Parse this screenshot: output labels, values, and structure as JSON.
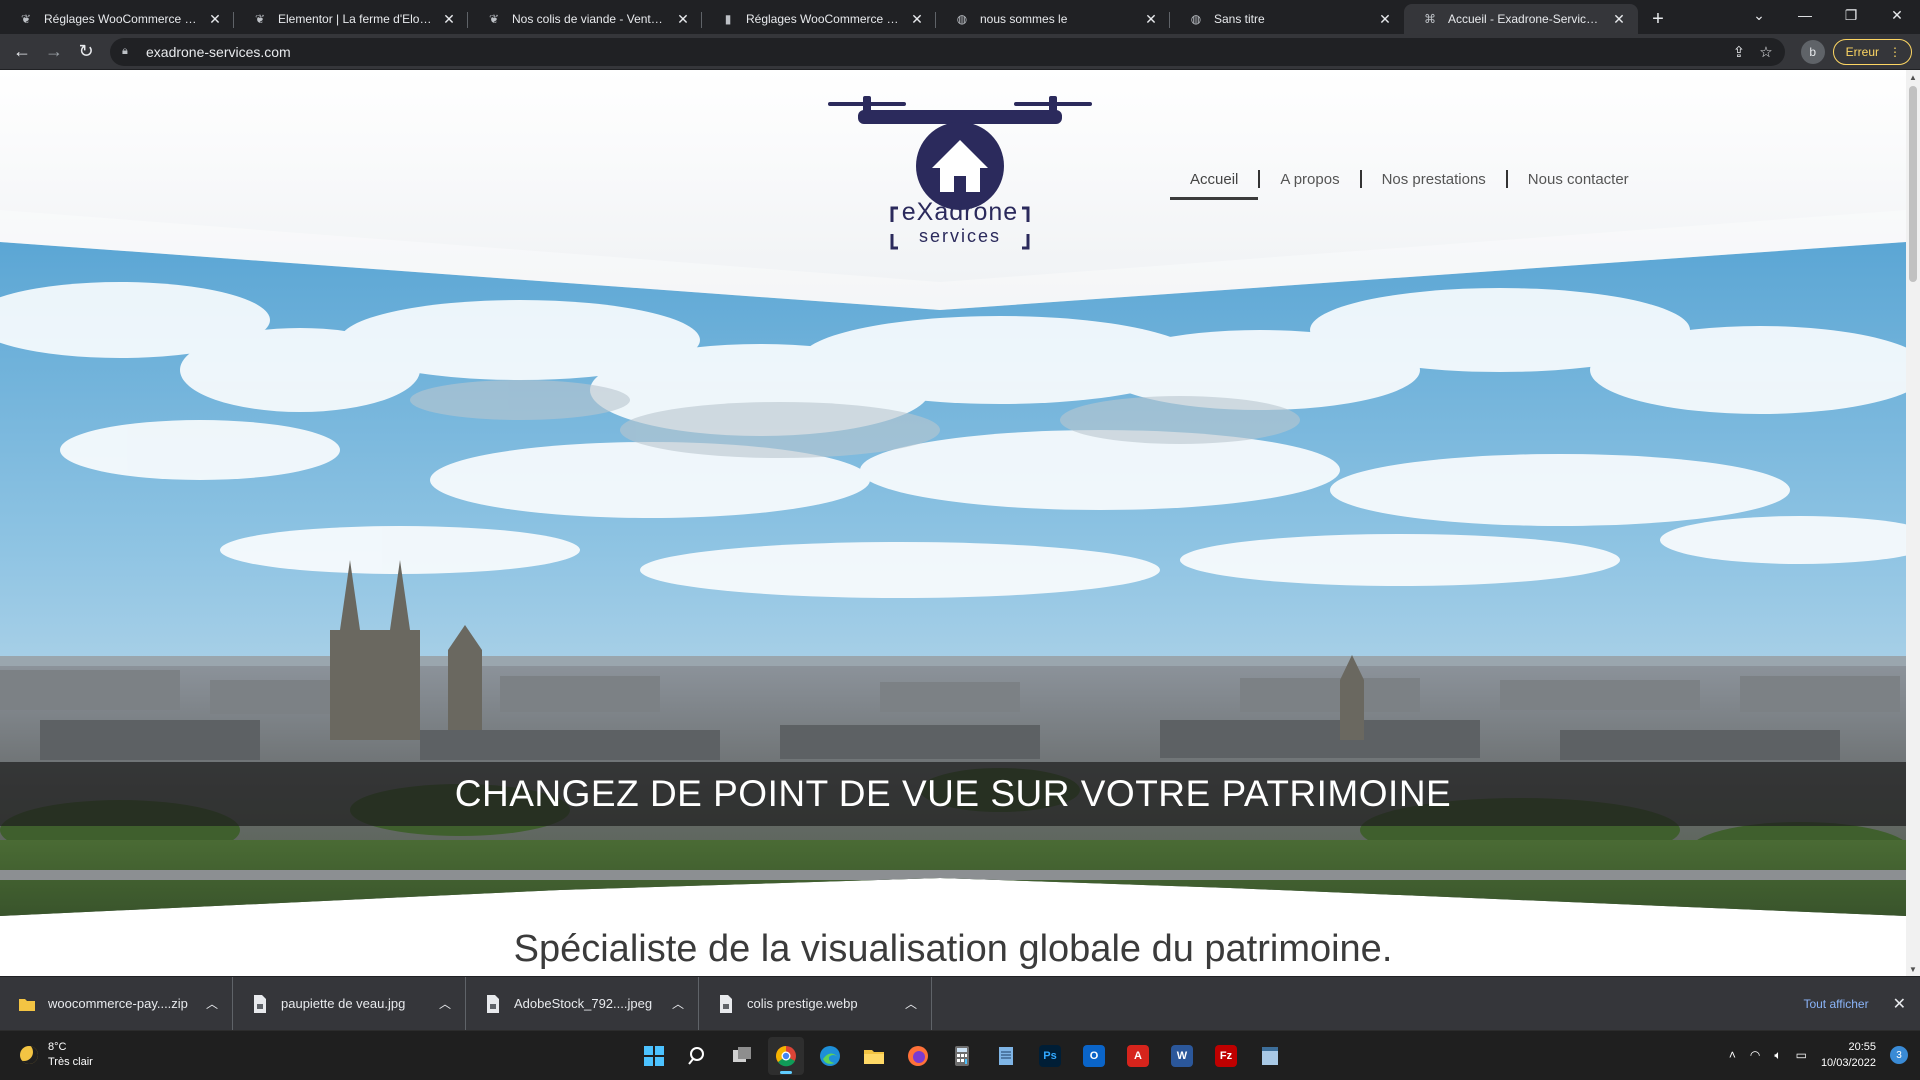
{
  "browser": {
    "tabs": [
      {
        "title": "Réglages WooCommerce ‹ Vente Directe",
        "favicon": "wordpress-icon",
        "active": false
      },
      {
        "title": "Elementor | La ferme d'Elodie",
        "favicon": "wordpress-icon",
        "active": false
      },
      {
        "title": "Nos colis de viande - Vente Directe",
        "favicon": "wordpress-icon",
        "active": false
      },
      {
        "title": "Réglages WooCommerce ‹ Le Dr",
        "favicon": "bottle-icon",
        "active": false
      },
      {
        "title": "nous sommes le",
        "favicon": "globe-icon",
        "active": false
      },
      {
        "title": "Sans titre",
        "favicon": "globe-icon",
        "active": false
      },
      {
        "title": "Accueil - Exadrone-Services Angers",
        "favicon": "drone-icon",
        "active": true
      }
    ],
    "url": "exadrone-services.com",
    "profile_initial": "b",
    "error_label": "Erreur"
  },
  "site": {
    "logo": {
      "line1": "eXadrone",
      "line2": "services",
      "color": "#2b2a5c"
    },
    "menu": [
      {
        "label": "Accueil",
        "active": true
      },
      {
        "label": "A propos",
        "active": false
      },
      {
        "label": "Nos prestations",
        "active": false
      },
      {
        "label": "Nous contacter",
        "active": false
      }
    ],
    "banner_text": "CHANGEZ DE POINT DE VUE SUR VOTRE PATRIMOINE",
    "subtitle": "Spécialiste de la visualisation globale du patrimoine."
  },
  "downloads": {
    "items": [
      {
        "name": "woocommerce-pay....zip",
        "icon": "folder-icon"
      },
      {
        "name": "paupiette de veau.jpg",
        "icon": "image-file-icon"
      },
      {
        "name": "AdobeStock_792....jpeg",
        "icon": "image-file-icon"
      },
      {
        "name": "colis prestige.webp",
        "icon": "image-file-icon"
      }
    ],
    "show_all": "Tout afficher"
  },
  "taskbar": {
    "weather_temp": "8°C",
    "weather_desc": "Très clair",
    "time": "20:55",
    "date": "10/03/2022",
    "notifications": "3",
    "apps": [
      {
        "name": "windows-start-icon"
      },
      {
        "name": "search-icon"
      },
      {
        "name": "task-view-icon"
      },
      {
        "name": "chrome-icon"
      },
      {
        "name": "edge-icon"
      },
      {
        "name": "file-explorer-icon"
      },
      {
        "name": "firefox-icon"
      },
      {
        "name": "calculator-icon"
      },
      {
        "name": "notepad-icon"
      },
      {
        "name": "photoshop-icon"
      },
      {
        "name": "outlook-icon"
      },
      {
        "name": "acrobat-icon"
      },
      {
        "name": "word-icon"
      },
      {
        "name": "filezilla-icon"
      },
      {
        "name": "notes-icon"
      }
    ]
  }
}
